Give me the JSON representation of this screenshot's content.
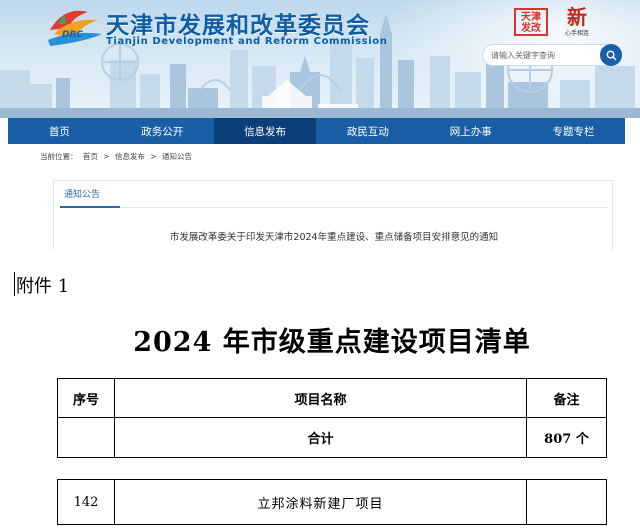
{
  "header": {
    "title": "天津市发展和改革委员会",
    "subtitle": "Tianjin Development and Reform Commission",
    "logo_text": "DRC",
    "badge_a_text": "天津 发改",
    "badge_b_text": "新",
    "badge_b_caption": "心手相连"
  },
  "search": {
    "placeholder": "请输入关键字查询"
  },
  "nav": {
    "items": [
      {
        "label": "首页"
      },
      {
        "label": "政务公开"
      },
      {
        "label": "信息发布"
      },
      {
        "label": "政民互动"
      },
      {
        "label": "网上办事"
      },
      {
        "label": "专题专栏"
      }
    ],
    "active_index": 2
  },
  "breadcrumb": {
    "prefix": "当前位置：",
    "items": [
      "首页",
      ">",
      "信息发布",
      ">",
      "通知公告"
    ]
  },
  "panel": {
    "tab_label": "通知公告",
    "notice_title": "市发展改革委关于印发天津市2024年重点建设、重点储备项目安排意见的通知"
  },
  "document": {
    "attachment_label": "附件 1",
    "title": "2024 年市级重点建设项目清单",
    "table": {
      "headers": [
        "序号",
        "项目名称",
        "备注"
      ],
      "total_row": {
        "index": "",
        "name": "合计",
        "note": "807 个"
      },
      "rows": [
        {
          "index": "142",
          "name": "立邦涂料新建厂项目",
          "note": ""
        }
      ]
    }
  },
  "colors": {
    "brand_blue": "#1a5fa5",
    "nav_active": "#0c3f7a",
    "title_blue": "#0d5ea6"
  }
}
